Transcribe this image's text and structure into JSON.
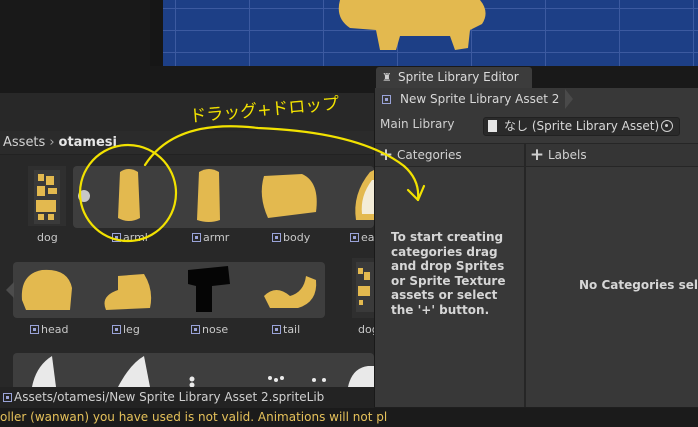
{
  "project": {
    "breadcrumb_root": "Assets",
    "breadcrumb_sep": "›",
    "breadcrumb_folder": "otamesi",
    "sprites": [
      {
        "label": "dog"
      },
      {
        "label": "arml"
      },
      {
        "label": "armr"
      },
      {
        "label": "body"
      },
      {
        "label": "ea"
      },
      {
        "label": "head"
      },
      {
        "label": "leg"
      },
      {
        "label": "nose"
      },
      {
        "label": "tail"
      },
      {
        "label": "dog"
      }
    ],
    "status_path": "Assets/otamesi/New Sprite Library Asset 2.spriteLib"
  },
  "console": {
    "message": "oller (wanwan) you have used is not valid. Animations will not pl"
  },
  "editor": {
    "tab_title": "Sprite Library Editor",
    "asset_name": "New Sprite Library Asset 2",
    "main_library_label": "Main Library",
    "main_library_value": "なし (Sprite Library Asset)",
    "categories_label": "Categories",
    "labels_label": "Labels",
    "categories_empty_msg": "To start creating categories drag and drop Sprites or Sprite Texture assets or select the '+' button.",
    "labels_empty_msg": "No Categories select"
  },
  "annotation": {
    "text": "ドラッグ+ドロップ",
    "color": "#f2e200"
  },
  "colors": {
    "sprite_yellow": "#e3b94f",
    "scene_blue": "#1d3f86",
    "panel_dark": "#282828",
    "editor_bg": "#383838"
  }
}
